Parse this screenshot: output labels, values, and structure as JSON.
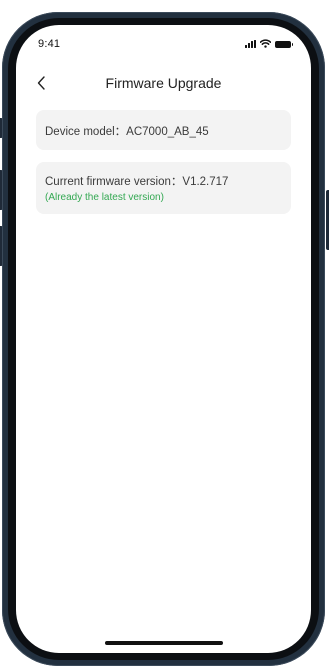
{
  "status_bar": {
    "time": "9:41",
    "signal_icon": "signal-bars-icon",
    "wifi_icon": "wifi-icon",
    "battery_icon": "battery-icon"
  },
  "nav": {
    "back_icon": "chevron-left-icon",
    "title": "Firmware Upgrade"
  },
  "device": {
    "model_label": "Device model：",
    "model_value": "AC7000_AB_45",
    "model_line": "Device model：AC7000_AB_45"
  },
  "firmware": {
    "version_line": "Current firmware version：V1.2.717",
    "status": "(Already the latest version)",
    "status_color": "#33a852"
  }
}
